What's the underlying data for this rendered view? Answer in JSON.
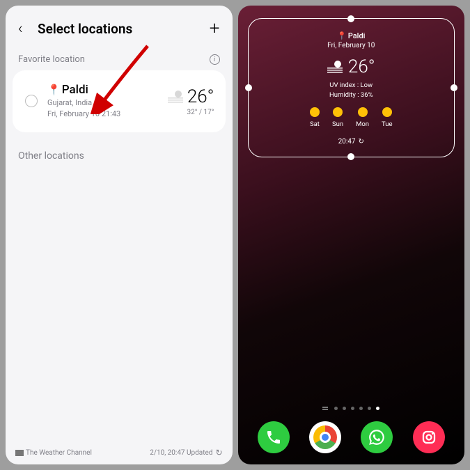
{
  "left": {
    "header_title": "Select locations",
    "favorite_label": "Favorite location",
    "card": {
      "name": "Paldi",
      "sub1": "Gujarat, India",
      "sub2": "Fri, February 10 21:43",
      "temp": "26°",
      "hilo": "32° / 17°"
    },
    "other_label": "Other locations",
    "footer_brand": "The Weather Channel",
    "footer_updated": "2/10, 20:47 Updated"
  },
  "right": {
    "widget": {
      "loc": "Paldi",
      "date": "Fri, February 10",
      "temp": "26°",
      "uv": "UV index : Low",
      "humidity": "Humidity : 36%",
      "days": [
        "Sat",
        "Sun",
        "Mon",
        "Tue"
      ],
      "time": "20:47"
    }
  }
}
